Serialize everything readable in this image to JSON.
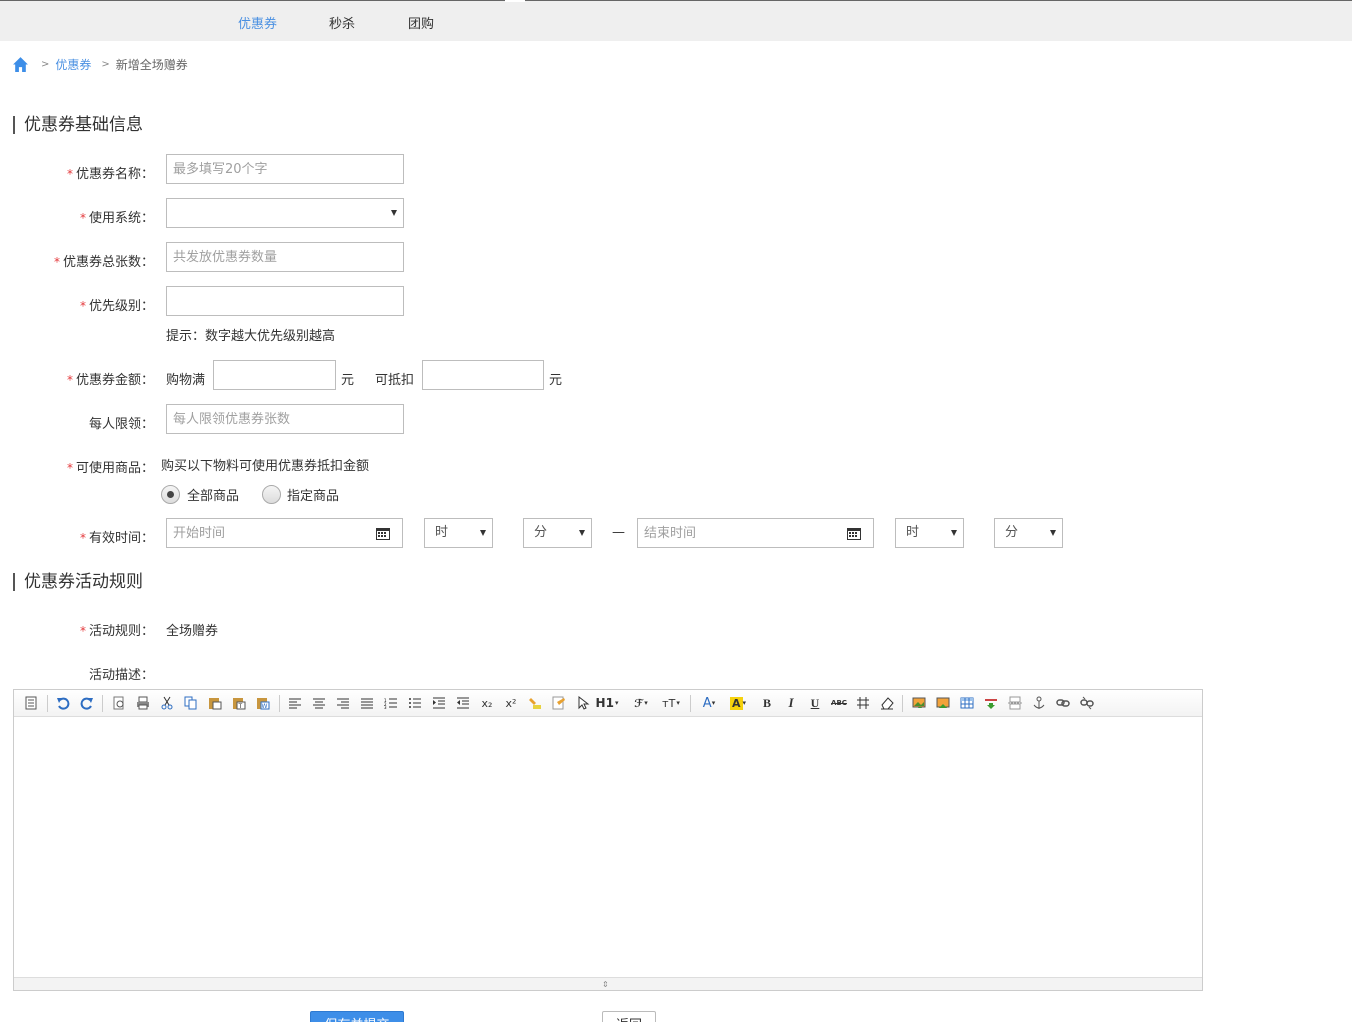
{
  "nav": {
    "tabs": [
      {
        "label": "优惠券",
        "active": true
      },
      {
        "label": "秒杀",
        "active": false
      },
      {
        "label": "团购",
        "active": false
      }
    ],
    "accent_color": "#4a90e2"
  },
  "breadcrumb": {
    "home_icon": "home-icon",
    "items": [
      "优惠券",
      "新增全场赠券"
    ],
    "separator": ">"
  },
  "sections": {
    "basic_title": "优惠券基础信息",
    "rules_title": "优惠券活动规则"
  },
  "form": {
    "required_mark": "*",
    "coupon_name": {
      "label": "优惠券名称：",
      "placeholder": "最多填写20个字",
      "value": ""
    },
    "system": {
      "label": "使用系统：",
      "value": ""
    },
    "total_count": {
      "label": "优惠券总张数：",
      "placeholder": "共发放优惠券数量",
      "value": ""
    },
    "priority": {
      "label": "优先级别：",
      "value": "",
      "hint": "提示：数字越大优先级别越高"
    },
    "amount": {
      "label": "优惠券金额：",
      "prefix": "购物满",
      "unit1": "元",
      "middle": "可抵扣",
      "unit2": "元",
      "min_value": "",
      "discount_value": ""
    },
    "per_limit": {
      "label": "每人限领：",
      "placeholder": "每人限领优惠券张数",
      "value": ""
    },
    "goods": {
      "label": "可使用商品：",
      "desc": "购买以下物料可使用优惠券抵扣金额",
      "options": [
        {
          "label": "全部商品",
          "checked": true
        },
        {
          "label": "指定商品",
          "checked": false
        }
      ]
    },
    "valid_time": {
      "label": "有效时间：",
      "start_placeholder": "开始时间",
      "end_placeholder": "结束时间",
      "hour": "时",
      "minute": "分",
      "dash": "—"
    },
    "rule": {
      "label": "活动规则：",
      "value": "全场赠券"
    },
    "description": {
      "label": "活动描述："
    }
  },
  "editor": {
    "toolbar": [
      "source-icon",
      "undo-icon",
      "redo-icon",
      "preview-icon",
      "print-icon",
      "cut-icon",
      "copy-icon",
      "paste-icon",
      "paste-text-icon",
      "paste-word-icon",
      "align-left-icon",
      "align-center-icon",
      "align-right-icon",
      "align-justify-icon",
      "ordered-list-icon",
      "unordered-list-icon",
      "indent-icon",
      "outdent-icon",
      "subscript-icon",
      "superscript-icon",
      "clear-format-icon",
      "select-all-icon",
      "select-icon",
      "heading-icon",
      "font-family-icon",
      "font-size-icon",
      "font-color-icon",
      "highlight-icon",
      "bold-icon",
      "italic-icon",
      "underline-icon",
      "strikethrough-icon",
      "line-height-icon",
      "eraser-icon",
      "image-icon",
      "multi-image-icon",
      "table-icon",
      "hr-icon",
      "page-break-icon",
      "anchor-icon",
      "link-icon",
      "unlink-icon"
    ],
    "labels": {
      "heading": "H1",
      "font_size": "тТ",
      "bold": "B",
      "italic": "I",
      "underline": "U",
      "strike": "ABC",
      "sub": "x₂",
      "sup": "x²",
      "font_color": "A",
      "highlight": "A"
    }
  },
  "buttons": {
    "save": "保存并提交",
    "back": "返回"
  }
}
